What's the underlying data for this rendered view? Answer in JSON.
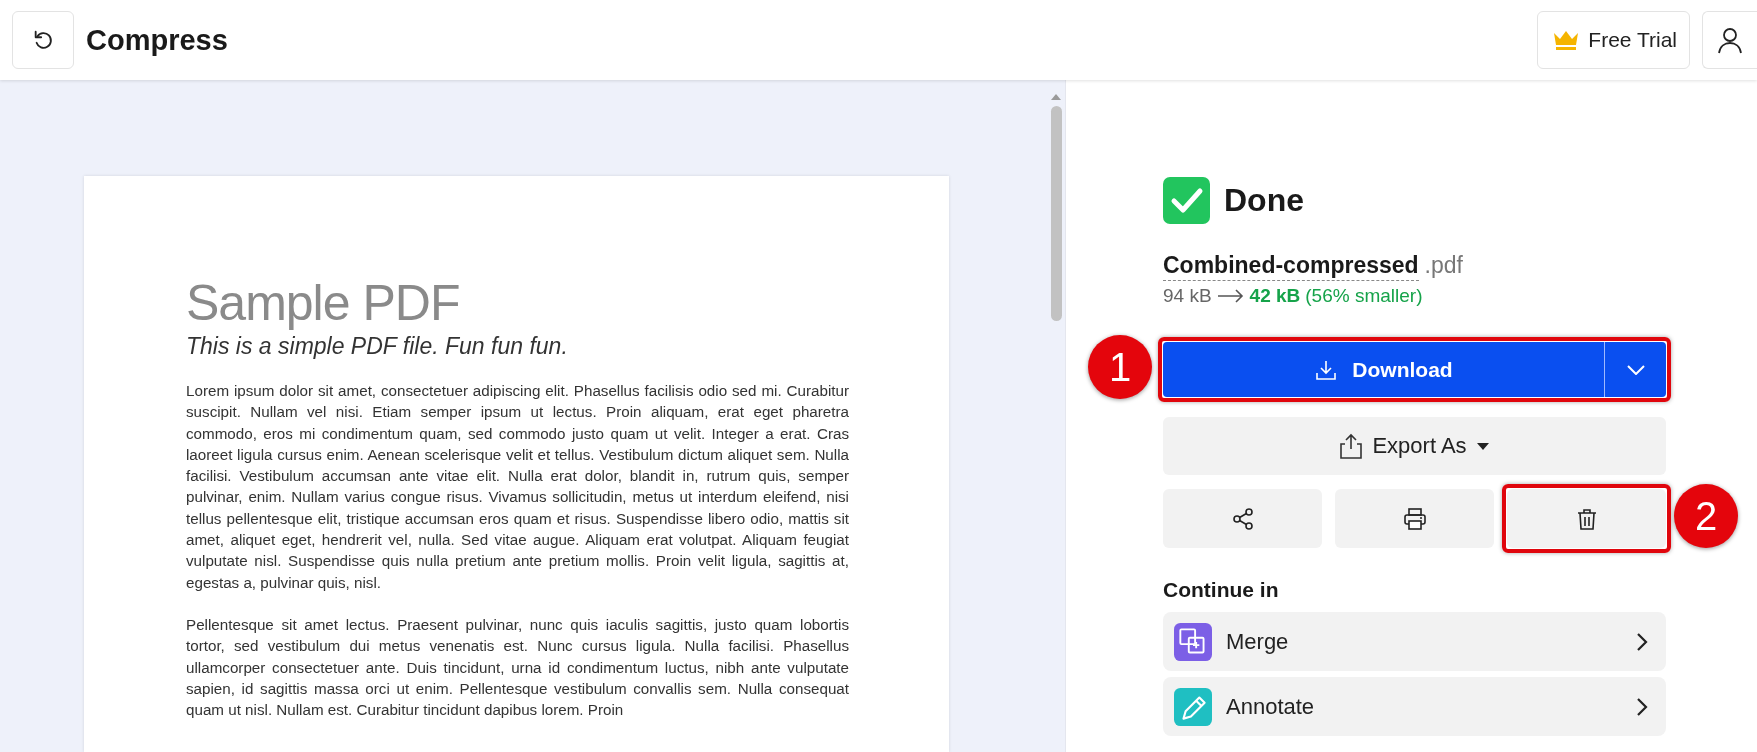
{
  "header": {
    "title": "Compress",
    "trial_button": "Free Trial"
  },
  "document": {
    "title": "Sample PDF",
    "subtitle": "This is a simple PDF file. Fun fun fun.",
    "paragraphs": [
      "Lorem ipsum dolor sit amet, consectetuer adipiscing elit. Phasellus facilisis odio sed mi. Curabitur suscipit. Nullam vel nisi. Etiam semper ipsum ut lectus. Proin aliquam, erat eget pharetra commodo, eros mi condimentum quam, sed commodo justo quam ut velit. Integer a erat. Cras laoreet ligula cursus enim. Aenean scelerisque velit et tellus. Vestibulum dictum aliquet sem. Nulla facilisi. Vestibulum accumsan ante vitae elit. Nulla erat dolor, blandit in, rutrum quis, semper pulvinar, enim. Nullam varius congue risus. Vivamus sollicitudin, metus ut interdum eleifend, nisi tellus pellentesque elit, tristique accumsan eros quam et risus. Suspendisse libero odio, mattis sit amet, aliquet eget, hendrerit vel, nulla. Sed vitae augue. Aliquam erat volutpat. Aliquam feugiat vulputate nisl. Suspendisse quis nulla pretium ante pretium mollis. Proin velit ligula, sagittis at, egestas a, pulvinar quis, nisl.",
      "Pellentesque sit amet lectus. Praesent pulvinar, nunc quis iaculis sagittis, justo quam lobortis tortor, sed vestibulum dui metus venenatis est. Nunc cursus ligula. Nulla facilisi. Phasellus ullamcorper consectetuer ante. Duis tincidunt, urna id condimentum luctus, nibh ante vulputate sapien, id sagittis massa orci ut enim. Pellentesque vestibulum convallis sem. Nulla consequat quam ut nisl. Nullam est. Curabitur tincidunt dapibus lorem. Proin"
    ]
  },
  "result": {
    "status": "Done",
    "file_name": "Combined-compressed",
    "file_ext": ".pdf",
    "size_before": "94 kB",
    "size_after": "42 kB",
    "reduction": "(56% smaller)",
    "download": {
      "label": "Download",
      "highlighted": true,
      "callout": "1"
    },
    "export_label": "Export As",
    "actions": [
      {
        "kind": "share",
        "highlighted": false
      },
      {
        "kind": "print",
        "highlighted": false
      },
      {
        "kind": "delete",
        "highlighted": true,
        "callout": "2"
      }
    ]
  },
  "continue": {
    "heading": "Continue in",
    "tools": [
      {
        "kind": "merge",
        "label": "Merge",
        "color": "#7c5fe6"
      },
      {
        "kind": "annotate",
        "label": "Annotate",
        "color": "#1fbfc2"
      }
    ]
  }
}
